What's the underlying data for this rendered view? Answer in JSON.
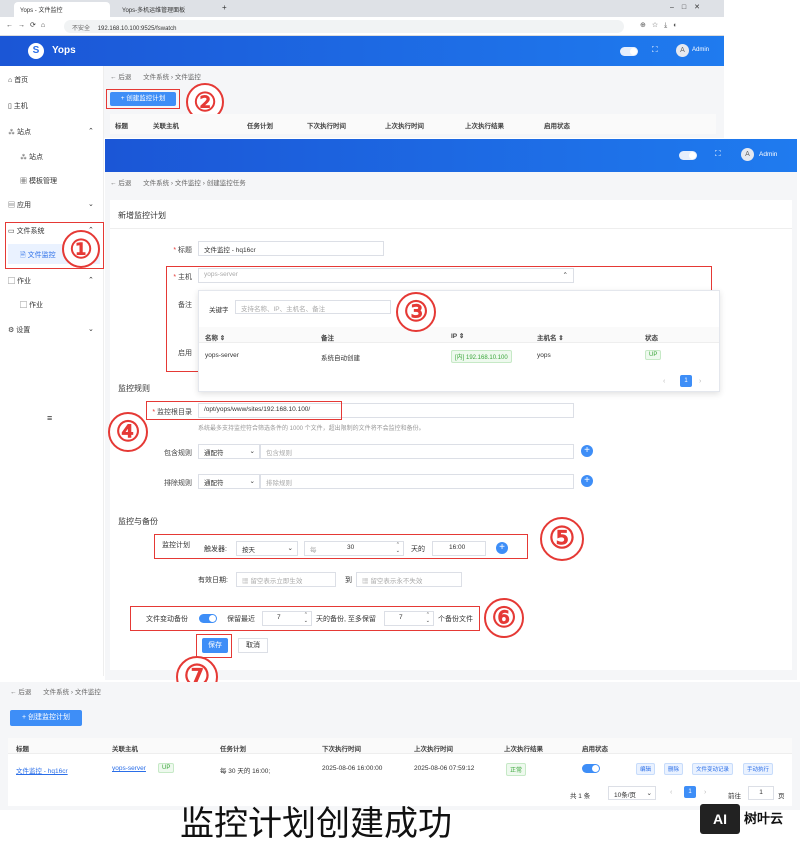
{
  "browser": {
    "tab1": "Yops - 文件监控",
    "tab2": "Yops-多机运维管理面板",
    "url_prefix": "不安全",
    "url": "192.168.10.100:9525/fswatch"
  },
  "app": {
    "name": "Yops",
    "logo": "S",
    "user": "Admin",
    "avatar": "A"
  },
  "sidebar": {
    "home": "首页",
    "host": "主机",
    "site": "站点",
    "site_sub": "站点",
    "template": "模板管理",
    "app": "应用",
    "fs": "文件系统",
    "fs_watch": "文件监控",
    "job": "作业",
    "job_sub": "作业",
    "settings": "设置",
    "menu_icon": "≡"
  },
  "list_top": {
    "back": "后退",
    "crumb1": "文件系统",
    "crumb2": "文件监控",
    "create_btn": "创建监控计划",
    "headers": [
      "标题",
      "关联主机",
      "任务计划",
      "下次执行时间",
      "上次执行时间",
      "上次执行结果",
      "启用状态"
    ]
  },
  "form": {
    "back": "后退",
    "crumb1": "文件系统",
    "crumb2": "文件监控",
    "crumb3": "创建监控任务",
    "title": "新增监控计划",
    "label_title": "标题",
    "title_value": "文件监控 - hq16cr",
    "label_host": "主机",
    "host_value": "yops-server",
    "label_remark": "备注",
    "label_enable": "启用",
    "dropdown": {
      "keyword_label": "关键字",
      "keyword_placeholder": "支持名称、IP、主机名、备注",
      "col_name": "名称",
      "col_remark": "备注",
      "col_ip": "IP",
      "col_hostname": "主机名",
      "col_status": "状态",
      "row_name": "yops-server",
      "row_remark": "系统自动创建",
      "row_ip": "[内] 192.168.10.100",
      "row_hostname": "yops",
      "row_status": "UP",
      "page": "1"
    },
    "section_rules": "监控规则",
    "label_root": "监控根目录",
    "root_value": "/opt/yops/www/sites/192.168.10.100/",
    "root_hint": "系统最多支持监控符合筛选条件的 1000 个文件，超出限制的文件将不会监控和备份。",
    "label_include": "包含规则",
    "include_type": "通配符",
    "include_placeholder": "包含规则",
    "label_exclude": "排除规则",
    "exclude_type": "通配符",
    "exclude_placeholder": "排除规则",
    "section_backup": "监控与备份",
    "label_plan": "监控计划",
    "trigger_label": "触发器:",
    "trigger_value": "按天",
    "every": "每",
    "every_value": "30",
    "day_unit": "天的",
    "time_value": "16:00",
    "label_valid": "有效日期:",
    "valid_start": "留空表示立即生效",
    "valid_to": "到",
    "valid_end": "留空表示永不失效",
    "label_backup": "文件变动备份",
    "keep_recent": "保留最近",
    "keep_days": "7",
    "days_backup": "天的备份, 至多保留",
    "keep_count": "7",
    "count_unit": "个备份文件",
    "save": "保存",
    "cancel": "取消"
  },
  "result": {
    "back": "后退",
    "crumb1": "文件系统",
    "crumb2": "文件监控",
    "create_btn": "创建监控计划",
    "headers": [
      "标题",
      "关联主机",
      "任务计划",
      "下次执行时间",
      "上次执行时间",
      "上次执行结果",
      "启用状态"
    ],
    "row": {
      "title": "文件监控 - hq16cr",
      "host": "yops-server",
      "host_status": "UP",
      "plan": "每 30 天的 16:00;",
      "next": "2025-08-06 16:00:00",
      "last": "2025-08-06 07:59:12",
      "result": "正常"
    },
    "ops": [
      "编辑",
      "删除",
      "文件变动记录",
      "手动执行"
    ],
    "total": "共 1 条",
    "page_size": "10条/页",
    "page": "1",
    "goto": "前往",
    "goto_value": "1",
    "page_unit": "页"
  },
  "annotations": [
    "①",
    "②",
    "③",
    "④",
    "⑤",
    "⑥",
    "⑦"
  ],
  "caption": "监控计划创建成功",
  "watermark": "树叶云",
  "watermark_logo": "AI"
}
